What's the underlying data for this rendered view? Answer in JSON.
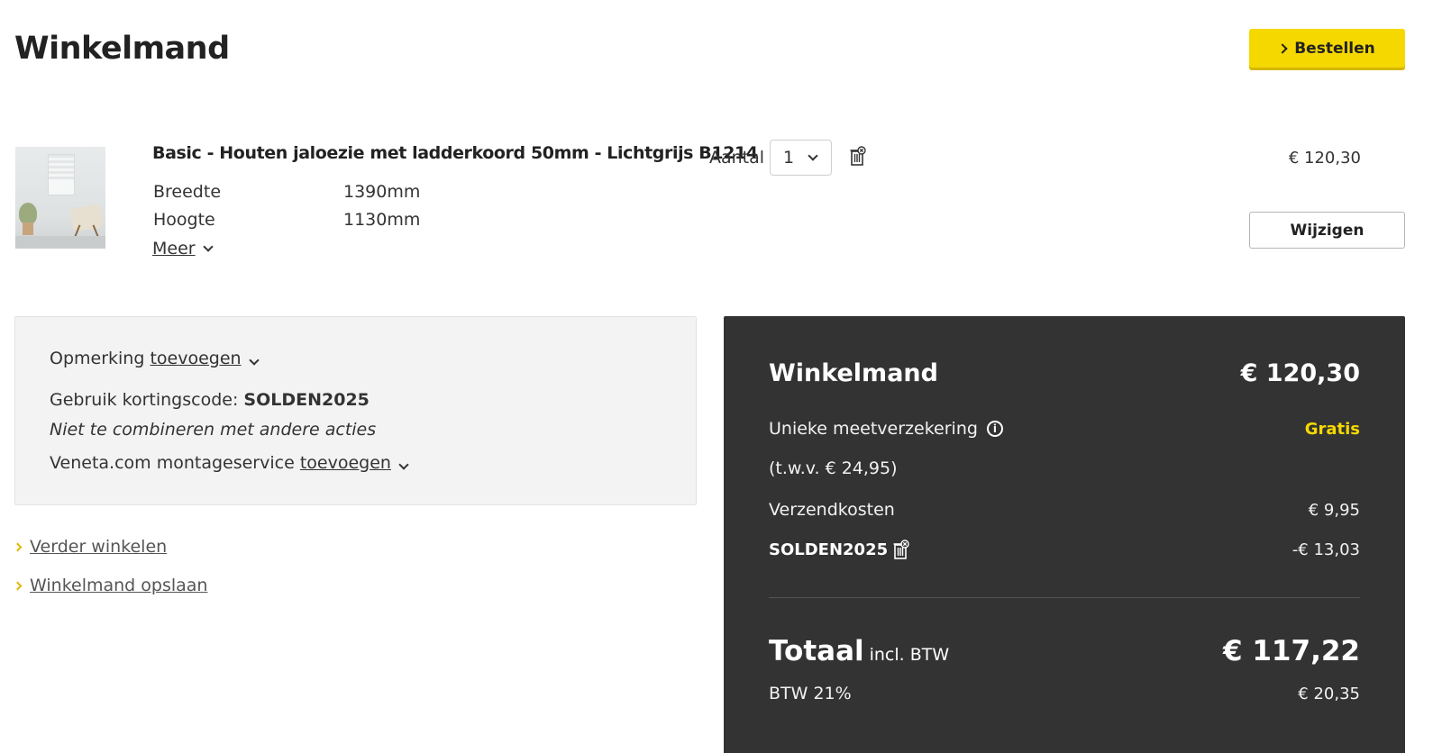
{
  "header": {
    "title": "Winkelmand",
    "order_button": "Bestellen"
  },
  "item": {
    "title": "Basic - Houten jaloezie met ladderkoord 50mm - Lichtgrijs B1214",
    "specs": [
      {
        "label": "Breedte",
        "value": "1390mm"
      },
      {
        "label": "Hoogte",
        "value": "1130mm"
      }
    ],
    "more_link": "Meer",
    "quantity_label": "Aantal",
    "quantity_value": "1",
    "price": "€ 120,30",
    "edit_button": "Wijzigen"
  },
  "options": {
    "remark_prefix": "Opmerking",
    "remark_link": "toevoegen",
    "discount_prefix": "Gebruik kortingscode:",
    "discount_code": "SOLDEN2025",
    "discount_note": "Niet te combineren met andere acties",
    "montage_prefix": "Veneta.com montageservice",
    "montage_link": "toevoegen"
  },
  "links": {
    "continue_shopping": "Verder winkelen",
    "save_cart": "Winkelmand opslaan"
  },
  "summary": {
    "title": "Winkelmand",
    "subtotal": "€ 120,30",
    "insurance_label": "Unieke meetverzekering",
    "insurance_value": "Gratis",
    "insurance_note": "(t.w.v. € 24,95)",
    "shipping_label": "Verzendkosten",
    "shipping_value": "€ 9,95",
    "code_label": "SOLDEN2025",
    "code_value": "-€ 13,03",
    "total_label": "Totaal",
    "total_suffix": "incl. BTW",
    "total_value": "€ 117,22",
    "vat_label": "BTW 21%",
    "vat_value": "€ 20,35"
  },
  "colors": {
    "accent": "#f5d800",
    "summary_bg": "#333333",
    "options_bg": "#f3f3f3"
  },
  "icons": [
    "chevron-right-icon",
    "chevron-down-icon",
    "trash-icon",
    "info-icon"
  ]
}
